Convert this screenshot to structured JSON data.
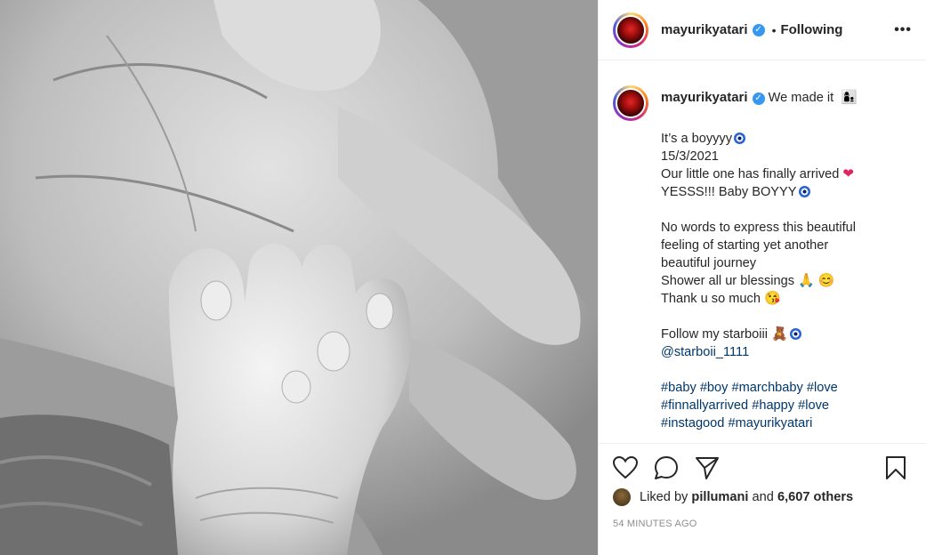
{
  "post": {
    "username": "mayurikyatari",
    "follow_separator": "•",
    "follow_status": "Following",
    "more_icon": "•••",
    "caption": {
      "first_line": "We made it",
      "lines_a": [
        "It’s a boyyyy",
        "15/3/2021",
        "Our little one has finally arrived",
        "YESSS!!! Baby BOYYY"
      ],
      "lines_b": [
        "No words to express this beautiful",
        "feeling of starting yet another",
        "beautiful journey",
        "Shower all ur blessings",
        "Thank u so much"
      ],
      "follow_line": "Follow my starboiii",
      "mention": "@starboii_1111",
      "hashtags_lines": [
        "#baby #boy #marchbaby #love",
        "#finnallyarrived #happy #love",
        "#instagood #mayurikyatari"
      ]
    },
    "emojis": {
      "family": "👩‍👦",
      "heart": "❤",
      "pray": "🙏",
      "smile": "😊",
      "kiss": "😘",
      "teddy": "🧸"
    },
    "likes": {
      "prefix": "Liked by",
      "user": "pillumani",
      "middle": "and",
      "others": "6,607 others"
    },
    "timestamp": "54 MINUTES AGO"
  }
}
